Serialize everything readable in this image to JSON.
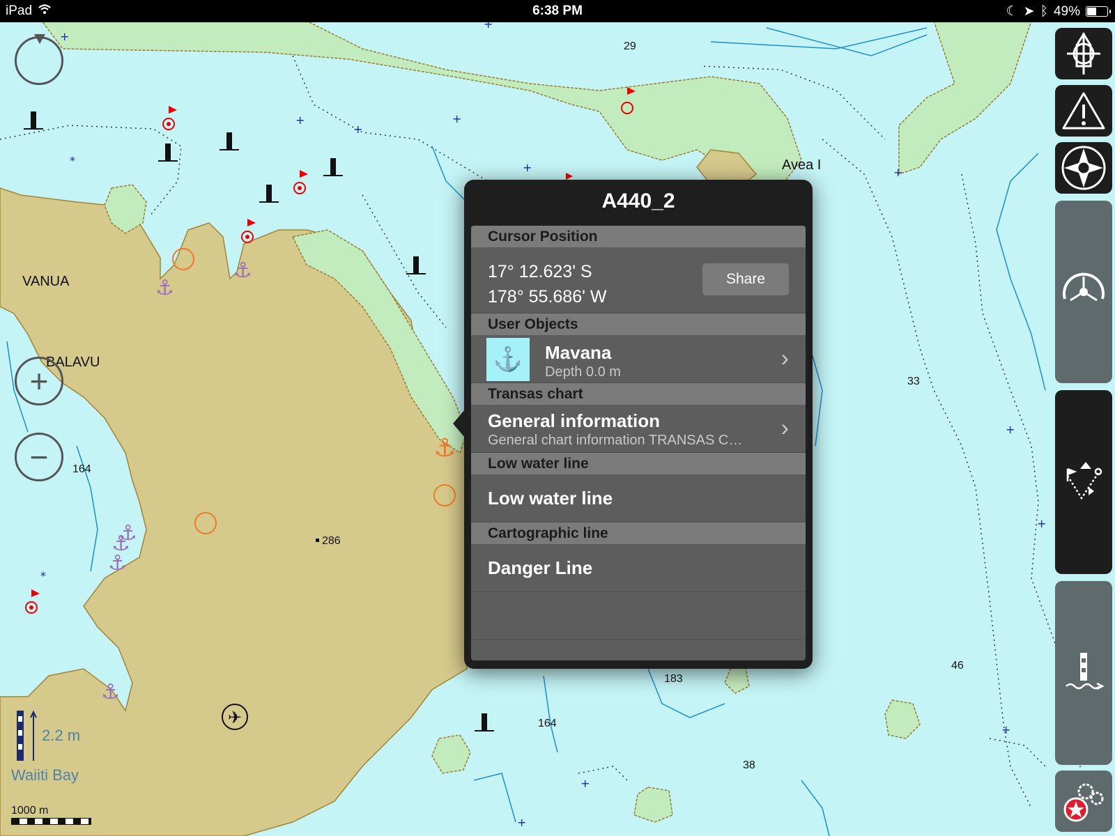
{
  "status_bar": {
    "device": "iPad",
    "time": "6:38 PM",
    "battery": "49%",
    "battery_level": 0.49
  },
  "map": {
    "place_labels": [
      "VANUA",
      "BALAVU",
      "Avea I"
    ],
    "depths": [
      "29",
      "164",
      "286",
      "33",
      "46",
      "183",
      "164",
      "38"
    ],
    "tide": {
      "value": "2.2 m",
      "place": "Waiiti Bay"
    },
    "scale": "1000 m"
  },
  "controls": {
    "zoom_in": "+",
    "zoom_out": "−"
  },
  "popup": {
    "title": "A440_2",
    "sections": {
      "cursor": "Cursor Position",
      "user_objects": "User Objects",
      "transas": "Transas chart",
      "low_water": "Low water line",
      "carto": "Cartographic line"
    },
    "cursor": {
      "lat": "17° 12.623' S",
      "lon": "178° 55.686' W",
      "share": "Share"
    },
    "user_object": {
      "name": "Mavana",
      "detail": "Depth 0.0 m"
    },
    "general": {
      "title": "General information",
      "detail": "General chart information TRANSAS C…"
    },
    "low_water_item": "Low water line",
    "danger_item": "Danger Line"
  },
  "sidebar_icons": [
    "ship-mode-icon",
    "warning-icon",
    "compass-icon",
    "helm-icon",
    "route-icon",
    "tide-station-icon",
    "settings-icon"
  ]
}
